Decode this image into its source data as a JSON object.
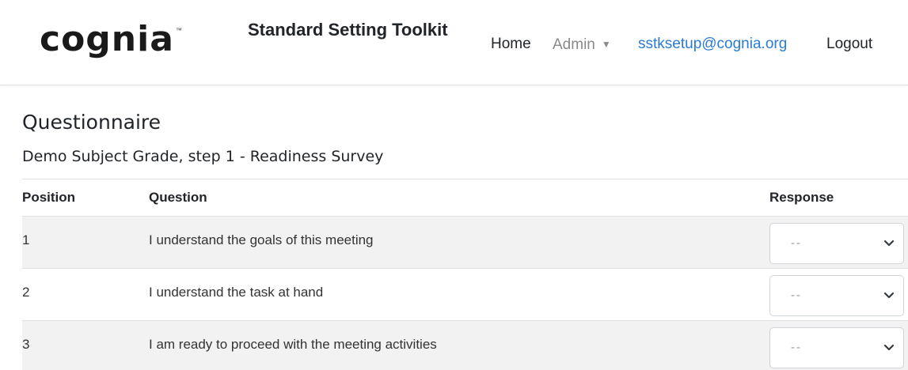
{
  "brand": {
    "logo_text": "cognia",
    "logo_tm": "™",
    "title": "Standard Setting Toolkit"
  },
  "nav": {
    "home": "Home",
    "admin": "Admin",
    "email": "sstksetup@cognia.org",
    "logout": "Logout",
    "colors": {
      "text": "#212529",
      "muted": "#8a8a8a",
      "link": "#2a7bd1"
    }
  },
  "page": {
    "heading": "Questionnaire",
    "subheading": "Demo Subject Grade, step 1 - Readiness Survey"
  },
  "table": {
    "headers": {
      "position": "Position",
      "question": "Question",
      "response": "Response"
    },
    "rows": [
      {
        "position": "1",
        "question": "I understand the goals of this meeting",
        "response": "--"
      },
      {
        "position": "2",
        "question": "I understand the task at hand",
        "response": "--"
      },
      {
        "position": "3",
        "question": "I am ready to proceed with the meeting activities",
        "response": "--"
      }
    ]
  },
  "icons": {
    "dropdown": "chevron-down-icon",
    "admin_caret": "caret-down-icon"
  }
}
